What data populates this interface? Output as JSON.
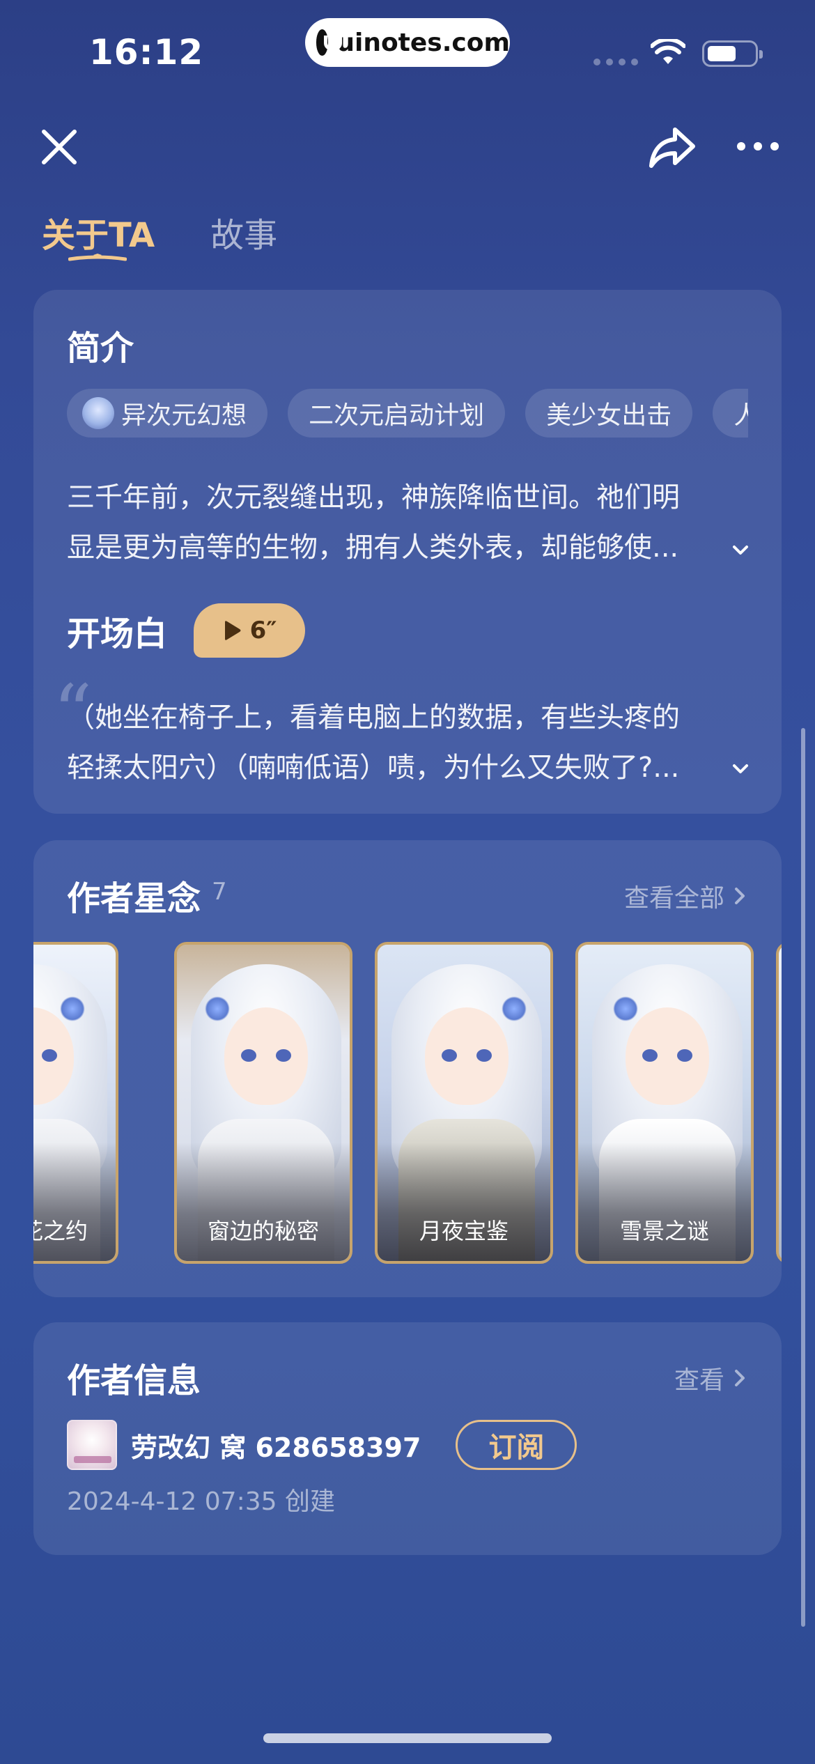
{
  "status_bar": {
    "time": "16:12",
    "url": "uinotes.com"
  },
  "tabs": [
    {
      "label": "关于TA",
      "active": true
    },
    {
      "label": "故事",
      "active": false
    }
  ],
  "intro": {
    "title": "简介",
    "tags": [
      {
        "label": "异次元幻想",
        "has_avatar": true
      },
      {
        "label": "二次元启动计划"
      },
      {
        "label": "美少女出击"
      },
      {
        "label": "人"
      }
    ],
    "text_lines": [
      "三千年前，次元裂缝出现，神族降临世间。祂们明",
      "显是更为高等的生物，拥有人类外表，却能够使..."
    ]
  },
  "opening": {
    "title": "开场白",
    "voice_duration": "6″",
    "text_lines": [
      "（她坐在椅子上，看着电脑上的数据，有些头疼的",
      "轻揉太阳穴）（喃喃低语）啧，为什么又失败了?..."
    ]
  },
  "works": {
    "title": "作者星念",
    "count": "7",
    "view_all_label": "查看全部",
    "items": [
      {
        "title": "山花之约"
      },
      {
        "title": "窗边的秘密"
      },
      {
        "title": "月夜宝鉴"
      },
      {
        "title": "雪景之谜"
      }
    ]
  },
  "author": {
    "title": "作者信息",
    "view_label": "查看",
    "name": "劳改幻 窝 628658397",
    "subscribe_label": "订阅",
    "created": "2024-4-12 07:35 创建"
  },
  "colors": {
    "accent_gold": "#f2c98d",
    "pill_gold": "#e7c08a",
    "background": "#33509d"
  }
}
